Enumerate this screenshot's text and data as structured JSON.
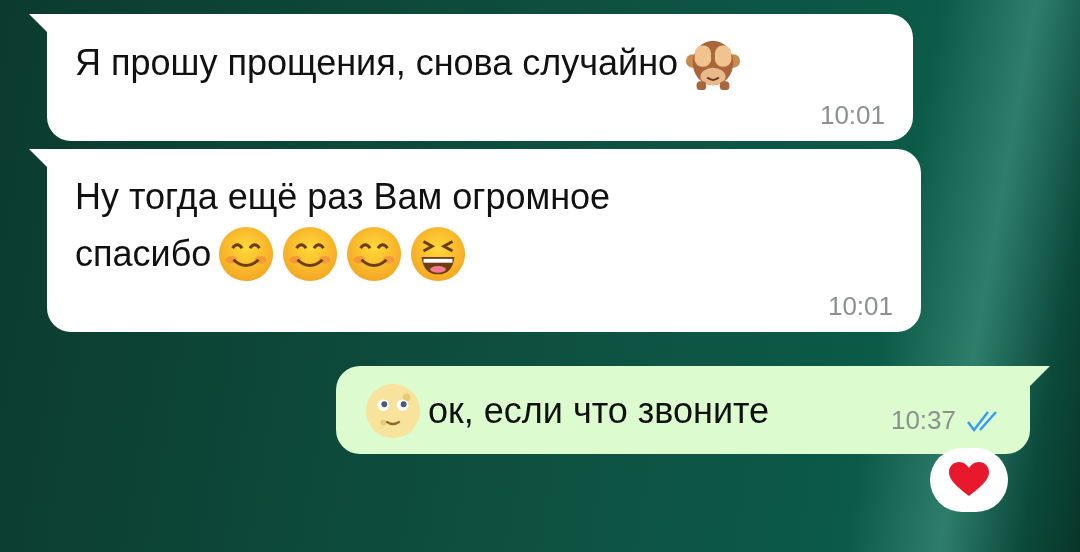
{
  "messages": [
    {
      "kind": "incoming",
      "lines": [
        [
          {
            "kind": "text",
            "text": "Я прошу прощения, снова случайно"
          },
          {
            "kind": "monkey"
          }
        ]
      ],
      "time": "10:01"
    },
    {
      "kind": "incoming",
      "lines": [
        [
          {
            "kind": "text",
            "text": "Ну тогда ещё раз Вам огромное"
          }
        ],
        [
          {
            "kind": "text",
            "text": "спасибо"
          },
          {
            "kind": "smile"
          },
          {
            "kind": "smile"
          },
          {
            "kind": "smile"
          },
          {
            "kind": "laugh"
          }
        ]
      ],
      "time": "10:01"
    },
    {
      "kind": "outgoing",
      "lines": [
        [
          {
            "kind": "moon"
          },
          {
            "kind": "text",
            "text": "ок, если что звоните"
          }
        ]
      ],
      "time": "10:37",
      "read": true,
      "reacted": true
    }
  ]
}
